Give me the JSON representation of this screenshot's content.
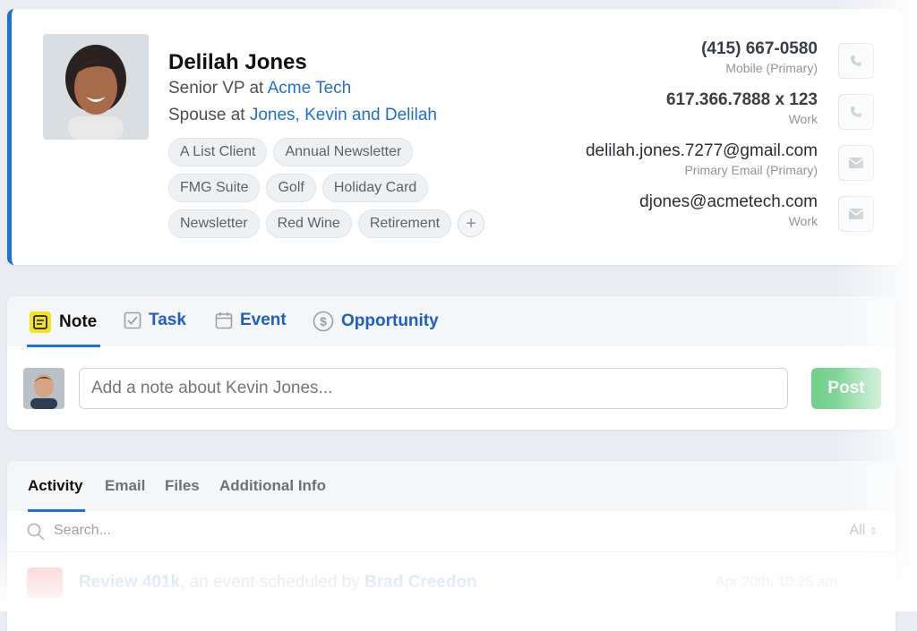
{
  "contact": {
    "name": "Delilah Jones",
    "title_prefix": "Senior VP at ",
    "company": "Acme Tech",
    "spouse_prefix": "Spouse at ",
    "household": "Jones, Kevin and Delilah",
    "tags": [
      [
        "A List Client",
        "Annual Newsletter"
      ],
      [
        "FMG Suite",
        "Golf",
        "Holiday Card"
      ],
      [
        "Newsletter",
        "Red Wine",
        "Retirement"
      ]
    ],
    "add_tag_symbol": "+",
    "methods": [
      {
        "value": "(415) 667-0580",
        "type": "Mobile (Primary)",
        "icon": "phone-icon"
      },
      {
        "value": "617.366.7888 x 123",
        "type": "Work",
        "icon": "phone-icon"
      },
      {
        "value": "delilah.jones.7277@gmail.com",
        "type": "Primary Email (Primary)",
        "icon": "mail-icon"
      },
      {
        "value": "djones@acmetech.com",
        "type": "Work",
        "icon": "mail-icon"
      }
    ],
    "accent_color": "#1e6fd9"
  },
  "composer": {
    "tabs": [
      {
        "label": "Note",
        "icon": "note-icon",
        "active": true
      },
      {
        "label": "Task",
        "icon": "checkbox-icon",
        "active": false
      },
      {
        "label": "Event",
        "icon": "calendar-icon",
        "active": false
      },
      {
        "label": "Opportunity",
        "icon": "dollar-icon",
        "active": false
      }
    ],
    "placeholder": "Add a note about Kevin Jones...",
    "post_label": "Post",
    "post_color": "#6ecf8a"
  },
  "activity": {
    "tabs": [
      {
        "label": "Activity",
        "active": true
      },
      {
        "label": "Email",
        "active": false
      },
      {
        "label": "Files",
        "active": false
      },
      {
        "label": "Additional Info",
        "active": false
      }
    ],
    "search_placeholder": "Search...",
    "filter_label": "All",
    "items": [
      {
        "title": "Review 401k",
        "middle": ", an event scheduled by ",
        "author": "Brad Creedon",
        "date": "Apr 20th, 10:25 am",
        "icon": "calendar-icon"
      }
    ]
  }
}
